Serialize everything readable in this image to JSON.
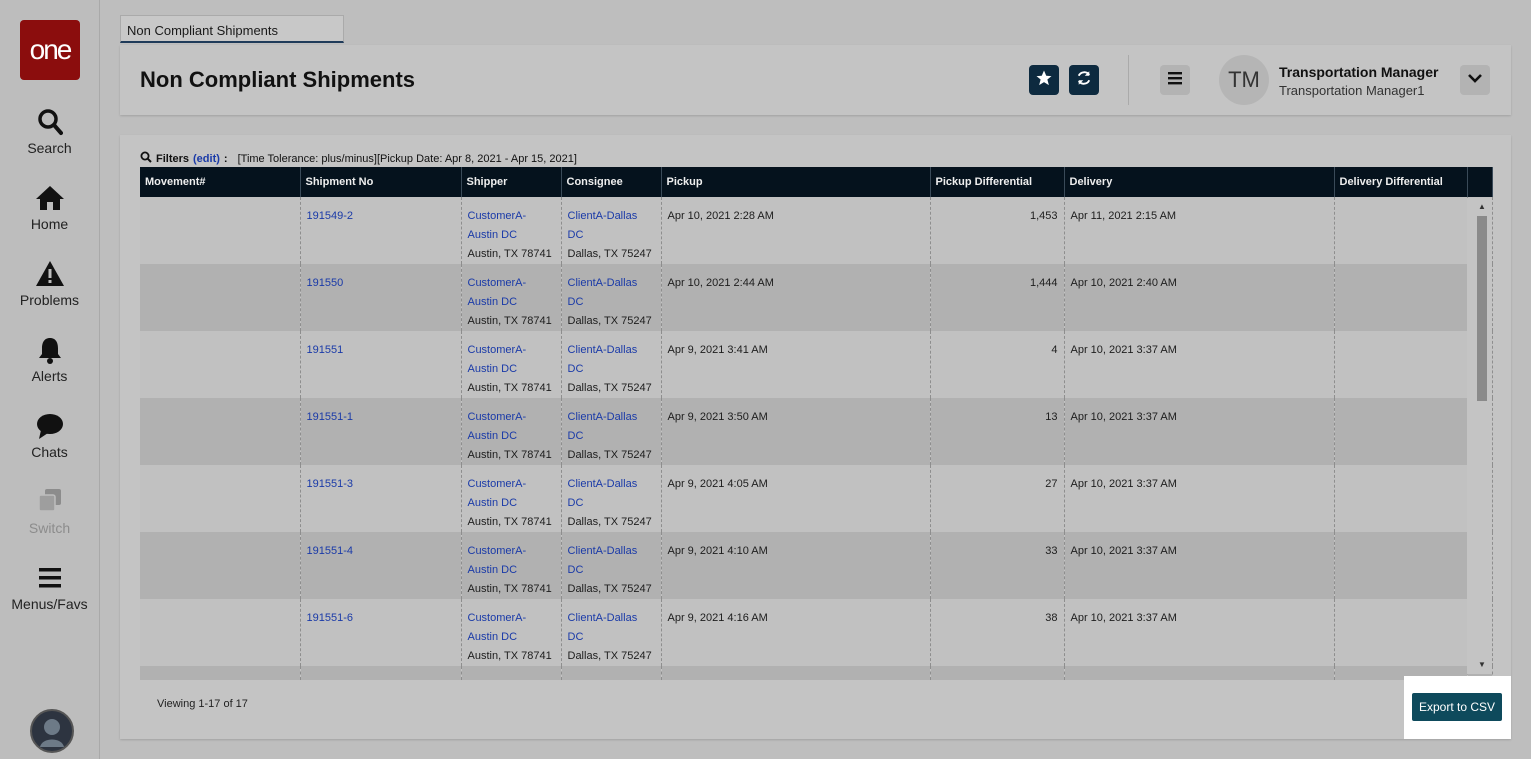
{
  "app": {
    "logo": "one"
  },
  "sidebar": {
    "items": [
      {
        "label": "Search",
        "icon": "search-icon"
      },
      {
        "label": "Home",
        "icon": "home-icon"
      },
      {
        "label": "Problems",
        "icon": "warning-icon"
      },
      {
        "label": "Alerts",
        "icon": "bell-icon"
      },
      {
        "label": "Chats",
        "icon": "chat-icon"
      },
      {
        "label": "Switch",
        "icon": "switch-icon"
      },
      {
        "label": "Menus/Favs",
        "icon": "hamburger-icon"
      }
    ]
  },
  "tab": {
    "label": "Non Compliant Shipments"
  },
  "header": {
    "title": "Non Compliant Shipments",
    "user": {
      "initials": "TM",
      "name": "Transportation Manager",
      "role": "Transportation Manager1"
    }
  },
  "filters": {
    "label": "Filters",
    "edit": "(edit)",
    "colon": ":",
    "value": "[Time Tolerance: plus/minus][Pickup Date: Apr 8, 2021 - Apr 15, 2021]"
  },
  "table": {
    "columns": [
      "Movement#",
      "Shipment No",
      "Shipper",
      "Consignee",
      "Pickup",
      "Pickup Differential",
      "Delivery",
      "Delivery Differential"
    ],
    "rows": [
      {
        "movement": "",
        "shipment": "191549-2",
        "shipper_l1": "CustomerA-",
        "shipper_l2": "Austin DC",
        "shipper_l3": "Austin, TX 78741",
        "cons_l1": "ClientA-Dallas",
        "cons_l2": "DC",
        "cons_l3": "Dallas, TX 75247",
        "pickup": "Apr 10, 2021 2:28 AM",
        "pickup_diff": "1,453",
        "delivery": "Apr 11, 2021 2:15 AM",
        "delivery_diff": ""
      },
      {
        "movement": "",
        "shipment": "191550",
        "shipper_l1": "CustomerA-",
        "shipper_l2": "Austin DC",
        "shipper_l3": "Austin, TX 78741",
        "cons_l1": "ClientA-Dallas",
        "cons_l2": "DC",
        "cons_l3": "Dallas, TX 75247",
        "pickup": "Apr 10, 2021 2:44 AM",
        "pickup_diff": "1,444",
        "delivery": "Apr 10, 2021 2:40 AM",
        "delivery_diff": ""
      },
      {
        "movement": "",
        "shipment": "191551",
        "shipper_l1": "CustomerA-",
        "shipper_l2": "Austin DC",
        "shipper_l3": "Austin, TX 78741",
        "cons_l1": "ClientA-Dallas",
        "cons_l2": "DC",
        "cons_l3": "Dallas, TX 75247",
        "pickup": "Apr 9, 2021 3:41 AM",
        "pickup_diff": "4",
        "delivery": "Apr 10, 2021 3:37 AM",
        "delivery_diff": ""
      },
      {
        "movement": "",
        "shipment": "191551-1",
        "shipper_l1": "CustomerA-",
        "shipper_l2": "Austin DC",
        "shipper_l3": "Austin, TX 78741",
        "cons_l1": "ClientA-Dallas",
        "cons_l2": "DC",
        "cons_l3": "Dallas, TX 75247",
        "pickup": "Apr 9, 2021 3:50 AM",
        "pickup_diff": "13",
        "delivery": "Apr 10, 2021 3:37 AM",
        "delivery_diff": ""
      },
      {
        "movement": "",
        "shipment": "191551-3",
        "shipper_l1": "CustomerA-",
        "shipper_l2": "Austin DC",
        "shipper_l3": "Austin, TX 78741",
        "cons_l1": "ClientA-Dallas",
        "cons_l2": "DC",
        "cons_l3": "Dallas, TX 75247",
        "pickup": "Apr 9, 2021 4:05 AM",
        "pickup_diff": "27",
        "delivery": "Apr 10, 2021 3:37 AM",
        "delivery_diff": ""
      },
      {
        "movement": "",
        "shipment": "191551-4",
        "shipper_l1": "CustomerA-",
        "shipper_l2": "Austin DC",
        "shipper_l3": "Austin, TX 78741",
        "cons_l1": "ClientA-Dallas",
        "cons_l2": "DC",
        "cons_l3": "Dallas, TX 75247",
        "pickup": "Apr 9, 2021 4:10 AM",
        "pickup_diff": "33",
        "delivery": "Apr 10, 2021 3:37 AM",
        "delivery_diff": ""
      },
      {
        "movement": "",
        "shipment": "191551-6",
        "shipper_l1": "CustomerA-",
        "shipper_l2": "Austin DC",
        "shipper_l3": "Austin, TX 78741",
        "cons_l1": "ClientA-Dallas",
        "cons_l2": "DC",
        "cons_l3": "Dallas, TX 75247",
        "pickup": "Apr 9, 2021 4:16 AM",
        "pickup_diff": "38",
        "delivery": "Apr 10, 2021 3:37 AM",
        "delivery_diff": ""
      }
    ]
  },
  "footer": {
    "viewing": "Viewing 1-17 of 17",
    "export_label": "Export to CSV"
  },
  "colors": {
    "logo_bg": "#8b0d0d",
    "header_dark": "#05121d",
    "button_dark": "#0d2a3f",
    "export_bg": "#0e4a5c",
    "link": "#1a3aa8"
  }
}
